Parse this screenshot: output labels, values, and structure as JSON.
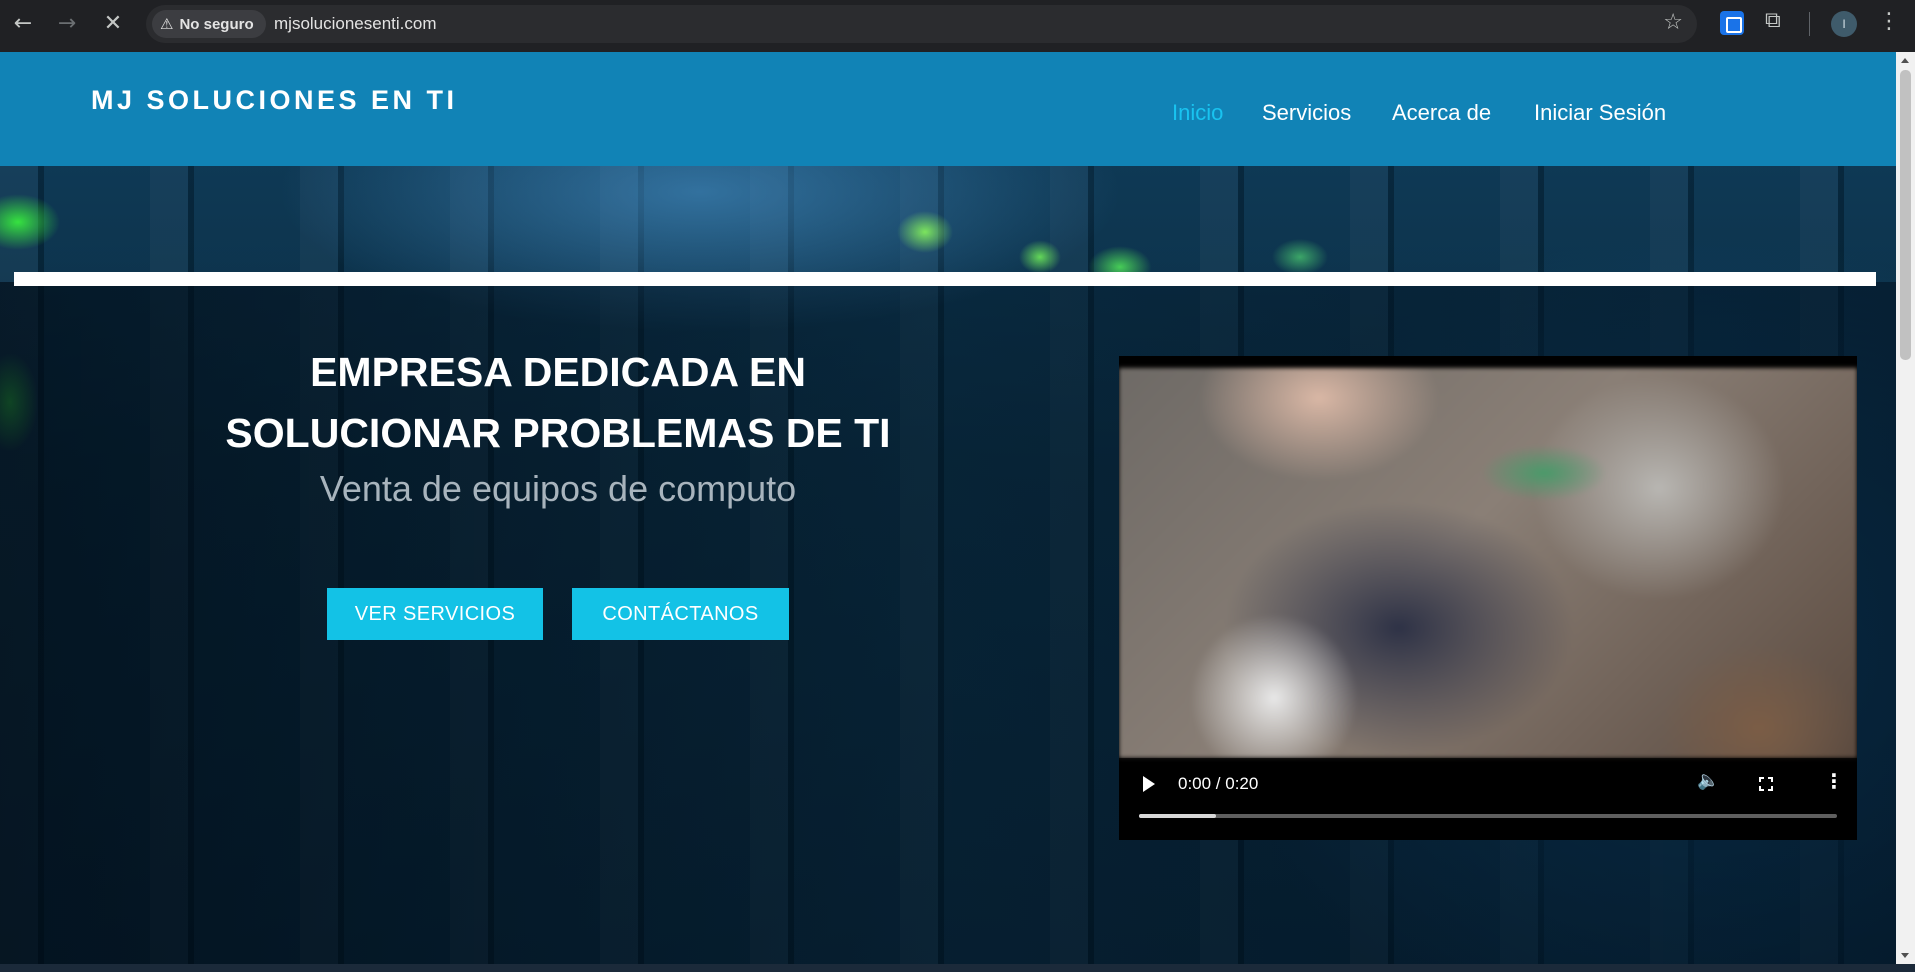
{
  "browser": {
    "back_icon": "arrow-left-icon",
    "forward_icon": "arrow-right-icon",
    "reload_icon": "close-icon",
    "security_label": "No seguro",
    "url": "mjsolucionesenti.com",
    "avatar_initial": "I"
  },
  "site": {
    "brand": "MJ SOLUCIONES EN TI",
    "nav": [
      {
        "label": "Inicio",
        "active": true
      },
      {
        "label": "Servicios",
        "active": false
      },
      {
        "label": "Acerca de",
        "active": false
      },
      {
        "label": "Iniciar Sesión",
        "active": false
      }
    ],
    "accent_color": "#19c3f0",
    "header_color": "#1183b6",
    "button_color": "#13c2e6"
  },
  "hero": {
    "title_line1": "EMPRESA DEDICADA EN",
    "title_line2": "SOLUCIONAR PROBLEMAS DE TI",
    "subtitle": "Venta de equipos de computo",
    "buttons": [
      {
        "label": "VER SERVICIOS"
      },
      {
        "label": "CONTÁCTANOS"
      }
    ]
  },
  "video": {
    "time": "0:00 / 0:20",
    "buffered_fraction": 0.11
  }
}
